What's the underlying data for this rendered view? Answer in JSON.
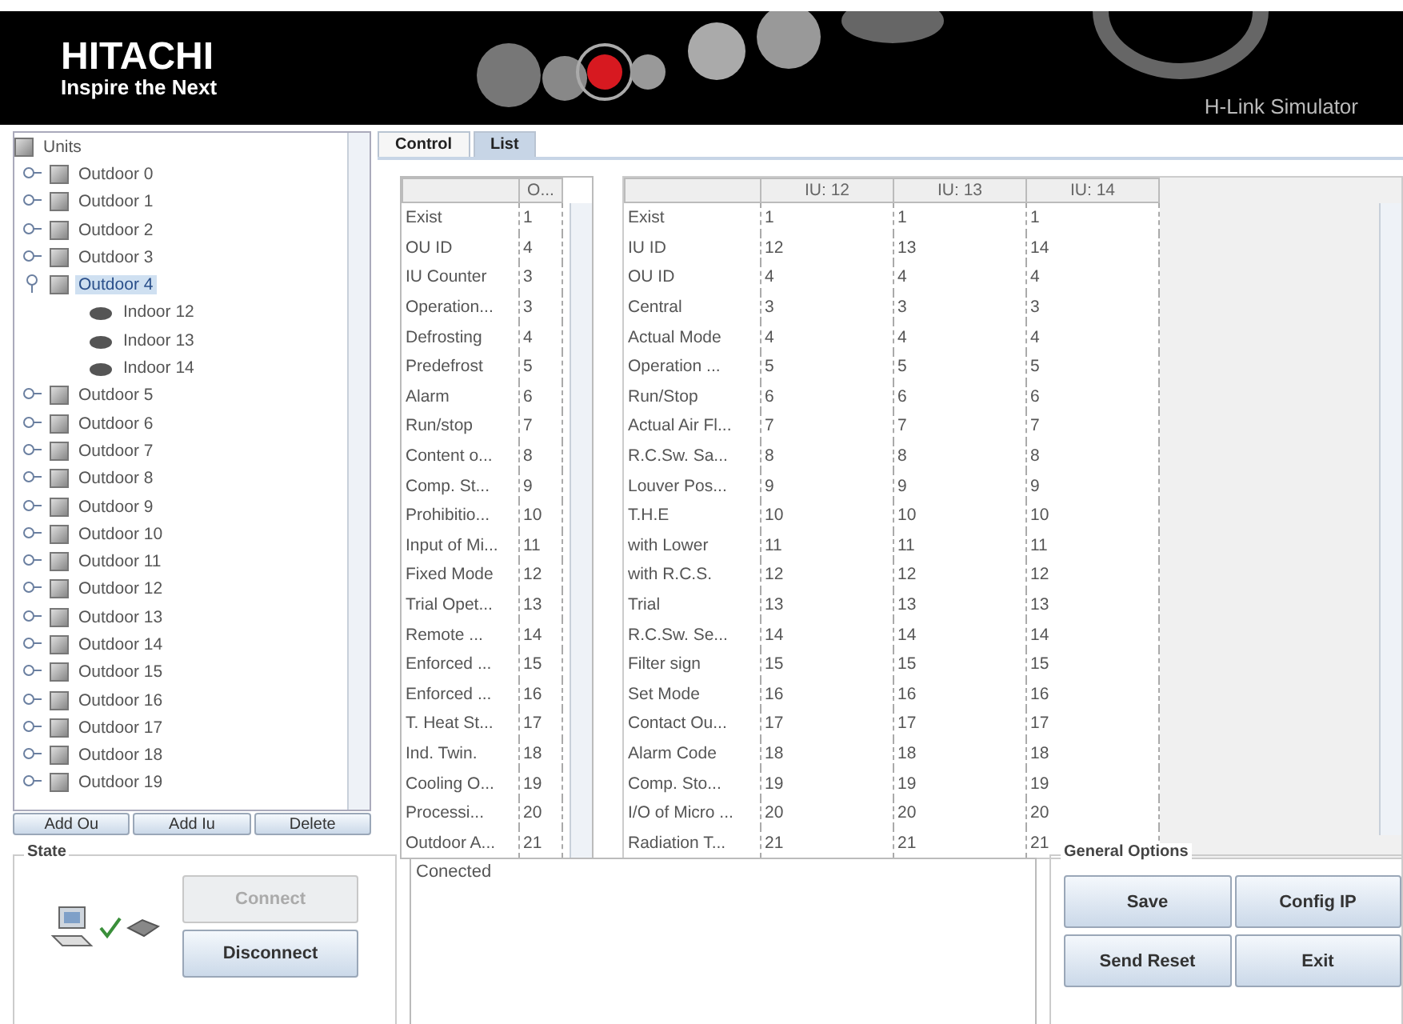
{
  "header": {
    "brand": "HITACHI",
    "tagline": "Inspire the Next",
    "product": "H-Link Simulator"
  },
  "tree": {
    "root": "Units",
    "items": [
      {
        "label": "Outdoor 0",
        "expanded": false,
        "selected": false
      },
      {
        "label": "Outdoor 1",
        "expanded": false,
        "selected": false
      },
      {
        "label": "Outdoor 2",
        "expanded": false,
        "selected": false
      },
      {
        "label": "Outdoor 3",
        "expanded": false,
        "selected": false
      },
      {
        "label": "Outdoor 4",
        "expanded": true,
        "selected": true,
        "children": [
          {
            "label": "Indoor 12",
            "selected": false
          },
          {
            "label": "Indoor 13",
            "selected": false
          },
          {
            "label": "Indoor 14",
            "selected": false
          }
        ]
      },
      {
        "label": "Outdoor 5",
        "expanded": false,
        "selected": false
      },
      {
        "label": "Outdoor 6",
        "expanded": false,
        "selected": false
      },
      {
        "label": "Outdoor 7",
        "expanded": false,
        "selected": false
      },
      {
        "label": "Outdoor 8",
        "expanded": false,
        "selected": false
      },
      {
        "label": "Outdoor 9",
        "expanded": false,
        "selected": false
      },
      {
        "label": "Outdoor 10",
        "expanded": false,
        "selected": false
      },
      {
        "label": "Outdoor 11",
        "expanded": false,
        "selected": false
      },
      {
        "label": "Outdoor 12",
        "expanded": false,
        "selected": false
      },
      {
        "label": "Outdoor 13",
        "expanded": false,
        "selected": false
      },
      {
        "label": "Outdoor 14",
        "expanded": false,
        "selected": false
      },
      {
        "label": "Outdoor 15",
        "expanded": false,
        "selected": false
      },
      {
        "label": "Outdoor 16",
        "expanded": false,
        "selected": false
      },
      {
        "label": "Outdoor 17",
        "expanded": false,
        "selected": false
      },
      {
        "label": "Outdoor 18",
        "expanded": false,
        "selected": false
      },
      {
        "label": "Outdoor 19",
        "expanded": false,
        "selected": false
      }
    ],
    "buttons": [
      "Add Ou",
      "Add Iu",
      "Delete"
    ]
  },
  "tabs": [
    {
      "label": "Control",
      "selected": false
    },
    {
      "label": "List",
      "selected": true
    }
  ],
  "outdoor_table": {
    "columns": [
      "O..."
    ],
    "rows": [
      {
        "name": "Exist",
        "value": "1"
      },
      {
        "name": "OU ID",
        "value": "4"
      },
      {
        "name": "IU Counter",
        "value": "3"
      },
      {
        "name": "Operation...",
        "value": "3"
      },
      {
        "name": "Defrosting",
        "value": "4"
      },
      {
        "name": "Predefrost",
        "value": "5"
      },
      {
        "name": "Alarm",
        "value": "6"
      },
      {
        "name": "Run/stop",
        "value": "7"
      },
      {
        "name": "Content o...",
        "value": "8"
      },
      {
        "name": "Comp. St...",
        "value": "9"
      },
      {
        "name": "Prohibitio...",
        "value": "10"
      },
      {
        "name": "Input of Mi...",
        "value": "11"
      },
      {
        "name": "Fixed Mode",
        "value": "12"
      },
      {
        "name": "Trial Opet...",
        "value": "13"
      },
      {
        "name": "Remote ...",
        "value": "14"
      },
      {
        "name": "Enforced ...",
        "value": "15"
      },
      {
        "name": "Enforced ...",
        "value": "16"
      },
      {
        "name": "T. Heat St...",
        "value": "17"
      },
      {
        "name": "Ind. Twin.",
        "value": "18"
      },
      {
        "name": "Cooling O...",
        "value": "19"
      },
      {
        "name": "Processi...",
        "value": "20"
      },
      {
        "name": "Outdoor A...",
        "value": "21"
      }
    ]
  },
  "indoor_table": {
    "columns": [
      "IU: 12",
      "IU: 13",
      "IU: 14"
    ],
    "rows": [
      {
        "name": "Exist",
        "values": [
          "1",
          "1",
          "1"
        ]
      },
      {
        "name": "IU ID",
        "values": [
          "12",
          "13",
          "14"
        ]
      },
      {
        "name": "OU ID",
        "values": [
          "4",
          "4",
          "4"
        ]
      },
      {
        "name": "Central",
        "values": [
          "3",
          "3",
          "3"
        ]
      },
      {
        "name": "Actual Mode",
        "values": [
          "4",
          "4",
          "4"
        ]
      },
      {
        "name": "Operation ...",
        "values": [
          "5",
          "5",
          "5"
        ]
      },
      {
        "name": "Run/Stop",
        "values": [
          "6",
          "6",
          "6"
        ]
      },
      {
        "name": "Actual Air Fl...",
        "values": [
          "7",
          "7",
          "7"
        ]
      },
      {
        "name": "R.C.Sw. Sa...",
        "values": [
          "8",
          "8",
          "8"
        ]
      },
      {
        "name": "Louver Pos...",
        "values": [
          "9",
          "9",
          "9"
        ]
      },
      {
        "name": "T.H.E",
        "values": [
          "10",
          "10",
          "10"
        ]
      },
      {
        "name": "with Lower",
        "values": [
          "11",
          "11",
          "11"
        ]
      },
      {
        "name": "with R.C.S.",
        "values": [
          "12",
          "12",
          "12"
        ]
      },
      {
        "name": "Trial",
        "values": [
          "13",
          "13",
          "13"
        ]
      },
      {
        "name": "R.C.Sw. Se...",
        "values": [
          "14",
          "14",
          "14"
        ]
      },
      {
        "name": "Filter sign",
        "values": [
          "15",
          "15",
          "15"
        ]
      },
      {
        "name": "Set Mode",
        "values": [
          "16",
          "16",
          "16"
        ]
      },
      {
        "name": "Contact Ou...",
        "values": [
          "17",
          "17",
          "17"
        ]
      },
      {
        "name": "Alarm Code",
        "values": [
          "18",
          "18",
          "18"
        ]
      },
      {
        "name": "Comp. Sto...",
        "values": [
          "19",
          "19",
          "19"
        ]
      },
      {
        "name": "I/O of Micro ...",
        "values": [
          "20",
          "20",
          "20"
        ]
      },
      {
        "name": "Radiation T...",
        "values": [
          "21",
          "21",
          "21"
        ]
      }
    ]
  },
  "state": {
    "title": "State",
    "connected": true,
    "buttons": [
      {
        "label": "Connect",
        "disabled": true
      },
      {
        "label": "Disconnect",
        "disabled": false
      }
    ]
  },
  "log": {
    "text": "Conected"
  },
  "options": {
    "title": "General Options",
    "buttons": [
      "Save",
      "Config IP",
      "Send Reset",
      "Exit"
    ]
  }
}
